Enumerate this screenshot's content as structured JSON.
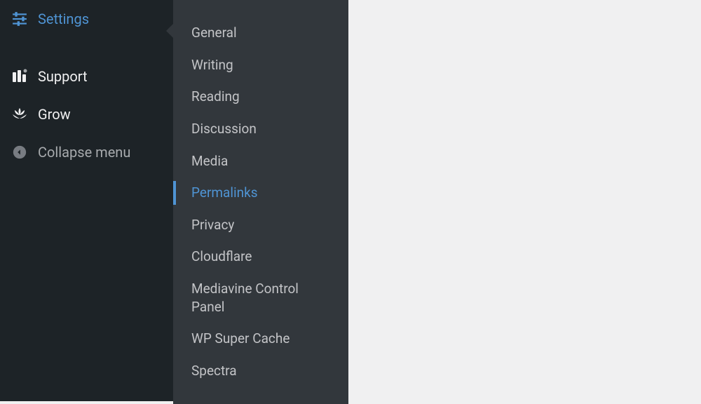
{
  "sidebar": {
    "items": [
      {
        "label": "Settings",
        "icon": "sliders",
        "active": true
      },
      {
        "label": "Support",
        "icon": "bars",
        "active": false
      },
      {
        "label": "Grow",
        "icon": "lotus",
        "active": false
      },
      {
        "label": "Collapse menu",
        "icon": "circle-left",
        "collapse": true
      }
    ]
  },
  "submenu": {
    "items": [
      {
        "label": "General",
        "active": false
      },
      {
        "label": "Writing",
        "active": false
      },
      {
        "label": "Reading",
        "active": false
      },
      {
        "label": "Discussion",
        "active": false
      },
      {
        "label": "Media",
        "active": false
      },
      {
        "label": "Permalinks",
        "active": true
      },
      {
        "label": "Privacy",
        "active": false
      },
      {
        "label": "Cloudflare",
        "active": false
      },
      {
        "label": "Mediavine Control Panel",
        "active": false
      },
      {
        "label": "WP Super Cache",
        "active": false
      },
      {
        "label": "Spectra",
        "active": false
      }
    ]
  }
}
